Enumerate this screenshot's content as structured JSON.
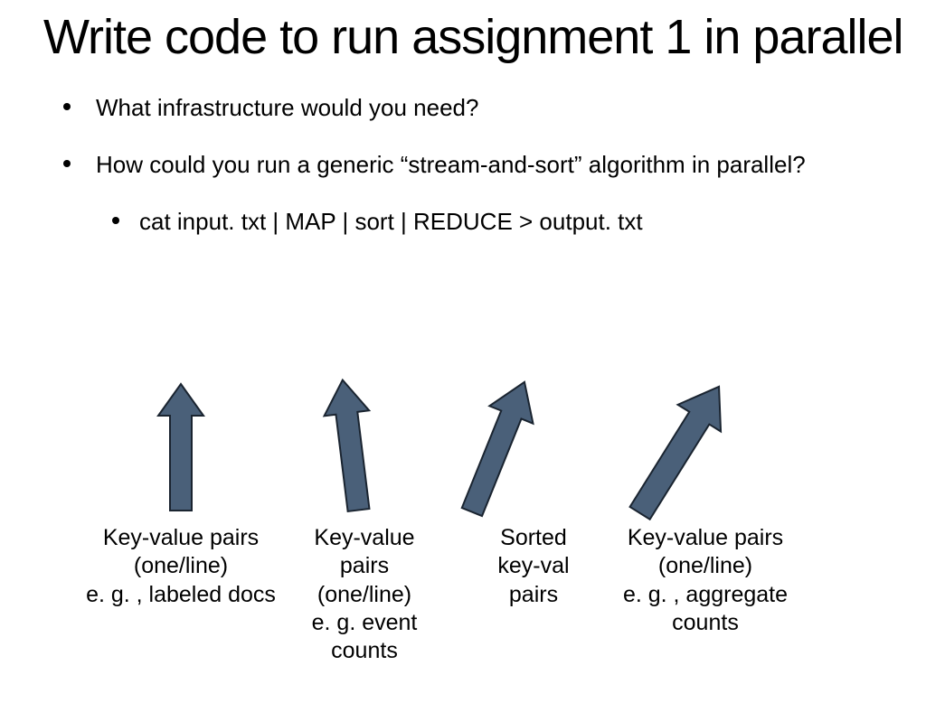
{
  "title": "Write code to run assignment 1 in parallel",
  "bullets": {
    "b1": "What infrastructure would you need?",
    "b2": "How could you run a generic “stream-and-sort” algorithm in parallel?",
    "sub": "cat input. txt | MAP | sort | REDUCE > output. txt"
  },
  "labels": {
    "l1_line1": "Key-value pairs",
    "l1_line2": "(one/line)",
    "l1_line3": "e. g. , labeled docs",
    "l2_line1": "Key-value",
    "l2_line2": "pairs",
    "l2_line3": "(one/line)",
    "l2_line4": "e. g. event",
    "l2_line5": "counts",
    "l3_line1": "Sorted",
    "l3_line2": "key-val",
    "l3_line3": "pairs",
    "l4_line1": "Key-value pairs",
    "l4_line2": "(one/line)",
    "l4_line3": "e. g. , aggregate",
    "l4_line4": "counts"
  },
  "colors": {
    "arrow_fill": "#4a6079",
    "arrow_stroke": "#1a2430"
  }
}
